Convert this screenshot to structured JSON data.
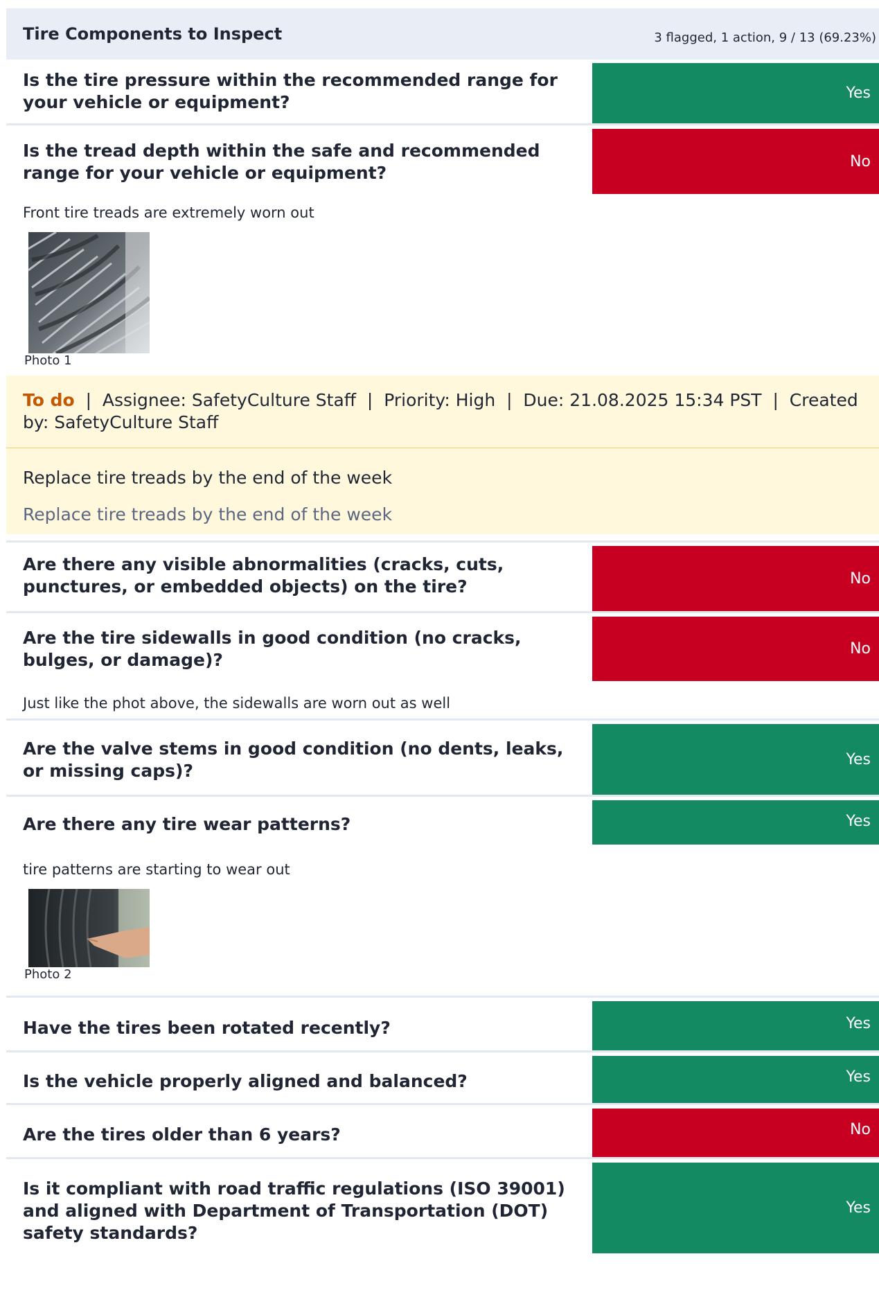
{
  "section": {
    "title": "Tire Components to Inspect",
    "stats": "3 flagged, 1 action, 9 / 13 (69.23%)"
  },
  "questions": [
    {
      "text": "Is the tire pressure within the recommended range for your vehicle or equipment?",
      "answer": "Yes"
    },
    {
      "text": "Is the tread depth within the safe and recommended range for your vehicle or equipment?",
      "answer": "No",
      "note": "Front tire treads are extremely worn out",
      "photo_caption": "Photo 1"
    },
    {
      "text": "Are there any visible abnormalities (cracks, cuts, punctures, or embedded objects) on the tire?",
      "answer": "No"
    },
    {
      "text": "Are the tire sidewalls in good condition (no cracks, bulges, or damage)?",
      "answer": "No",
      "note": "Just like the phot above, the sidewalls are worn out as well"
    },
    {
      "text": "Are the valve stems in good condition (no dents, leaks, or missing caps)?",
      "answer": "Yes"
    },
    {
      "text": "Are there any tire wear patterns?",
      "answer": "Yes",
      "note": "tire patterns are starting to wear out",
      "photo_caption": "Photo 2"
    },
    {
      "text": "Have the tires been rotated recently?",
      "answer": "Yes"
    },
    {
      "text": "Is the vehicle properly aligned and balanced?",
      "answer": "Yes"
    },
    {
      "text": "Are the tires older than 6 years?",
      "answer": "No"
    },
    {
      "text": "Is it compliant with road traffic regulations (ISO 39001) and aligned with Department of Transportation (DOT) safety standards?",
      "answer": "Yes"
    }
  ],
  "action": {
    "status": "To do",
    "assignee": "Assignee: SafetyCulture Staff",
    "priority": "Priority: High",
    "due": "Due: 21.08.2025 15:34 PST",
    "created": "Created by: SafetyCulture Staff",
    "title": "Replace tire treads by the end of the week",
    "description": "Replace tire treads by the end of the week"
  },
  "colors": {
    "yes": "#138a61",
    "no": "#c70022",
    "header_bg": "#e9eef6",
    "action_bg": "#fff8dd",
    "action_status": "#c25800"
  }
}
